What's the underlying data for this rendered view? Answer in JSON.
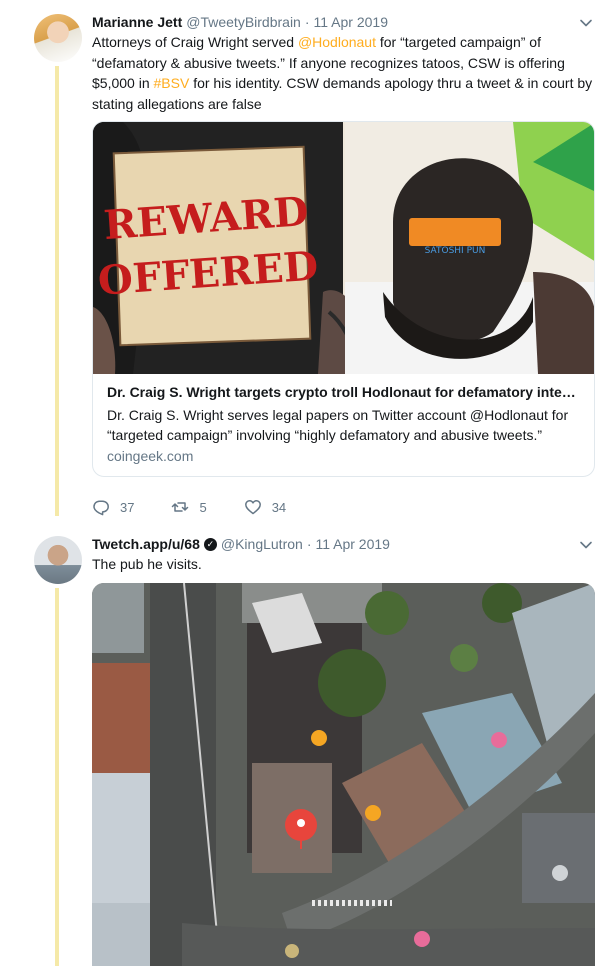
{
  "tweets": [
    {
      "name": "Marianne Jett",
      "handle": "@TweetyBirdbrain",
      "separator": "·",
      "date": "11 Apr 2019",
      "text_parts": {
        "p1": "Attorneys of Craig Wright served ",
        "mention": "@Hodlonaut",
        "p2": " for “targeted campaign” of “defamatory & abusive tweets.” If anyone recognizes tatoos, CSW is offering $5,000 in ",
        "hashtag": "#BSV",
        "p3": " for his identity. CSW demands apology thru a tweet & in court by stating allegations are false"
      },
      "card": {
        "sign_line1": "REWARD",
        "sign_line2": "OFFERED",
        "cap_text": "SATOSHI PUN",
        "title": "Dr. Craig S. Wright targets crypto troll Hodlonaut for defamatory inte…",
        "description": "Dr. Craig S. Wright serves legal papers on Twitter account @Hodlonaut for “targeted campaign” involving “highly defamatory and abusive tweets.”",
        "domain": "coingeek.com"
      },
      "actions": {
        "replies": "37",
        "retweets": "5",
        "likes": "34"
      }
    },
    {
      "name": "Twetch.app/u/68",
      "verified_icon": "verified-badge-icon",
      "handle": "@KingLutron",
      "separator": "·",
      "date": "11 Apr 2019",
      "text": "The pub he visits."
    }
  ],
  "icons": {
    "reply": "reply-icon",
    "retweet": "retweet-icon",
    "like": "heart-icon",
    "more": "chevron-down-icon",
    "map_pin": "map-pin-icon"
  },
  "colors": {
    "accent": "#ffad1f",
    "thread_line": "#f5e9a8",
    "secondary_text": "#657786",
    "map_pin": "#e8453c"
  }
}
